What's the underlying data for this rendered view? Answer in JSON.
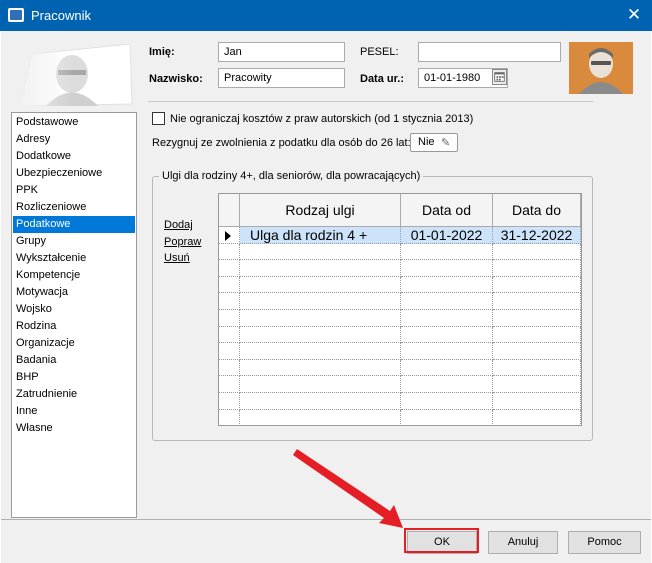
{
  "window": {
    "title": "Pracownik",
    "close_glyph": "✕",
    "icon": "app-logo-icon"
  },
  "nav": {
    "items": [
      "Podstawowe",
      "Adresy",
      "Dodatkowe",
      "Ubezpieczeniowe",
      "PPK",
      "Rozliczeniowe",
      "Podatkowe",
      "Grupy",
      "Wykształcenie",
      "Kompetencje",
      "Motywacja",
      "Wojsko",
      "Rodzina",
      "Organizacje",
      "Badania",
      "BHP",
      "Zatrudnienie",
      "Inne",
      "Własne"
    ],
    "selected": "Podatkowe"
  },
  "form": {
    "imie_label": "Imię:",
    "imie_value": "Jan",
    "nazwisko_label": "Nazwisko:",
    "nazwisko_value": "Pracowity",
    "pesel_label": "PESEL:",
    "pesel_value": "",
    "data_label": "Data ur.:",
    "data_value": "01-01-1980"
  },
  "options": {
    "costs_checkbox_label": "Nie ograniczaj kosztów z praw autorskich (od 1 stycznia 2013)",
    "costs_checked": false,
    "zwolnienie_label": "Rezygnuj ze zwolnienia z podatku dla osób do 26 lat:",
    "zwolnienie_value": "Nie"
  },
  "ulgi": {
    "group_title": "Ulgi dla rodziny 4+, dla seniorów, dla powracających)",
    "actions": {
      "add": "Dodaj",
      "edit": "Popraw",
      "delete": "Usuń"
    },
    "columns": [
      "Rodzaj ulgi",
      "Data od",
      "Data do"
    ],
    "rows": [
      {
        "rodzaj": "Ulga dla rodzin 4 +",
        "od": "01-01-2022",
        "do": "31-12-2022"
      }
    ]
  },
  "buttons": {
    "ok": "OK",
    "cancel": "Anuluj",
    "help": "Pomoc"
  },
  "colors": {
    "titlebar": "#0063b1",
    "selection": "#0078d7",
    "highlight": "#e51e25",
    "avatar_bg": "#d98a3d"
  }
}
